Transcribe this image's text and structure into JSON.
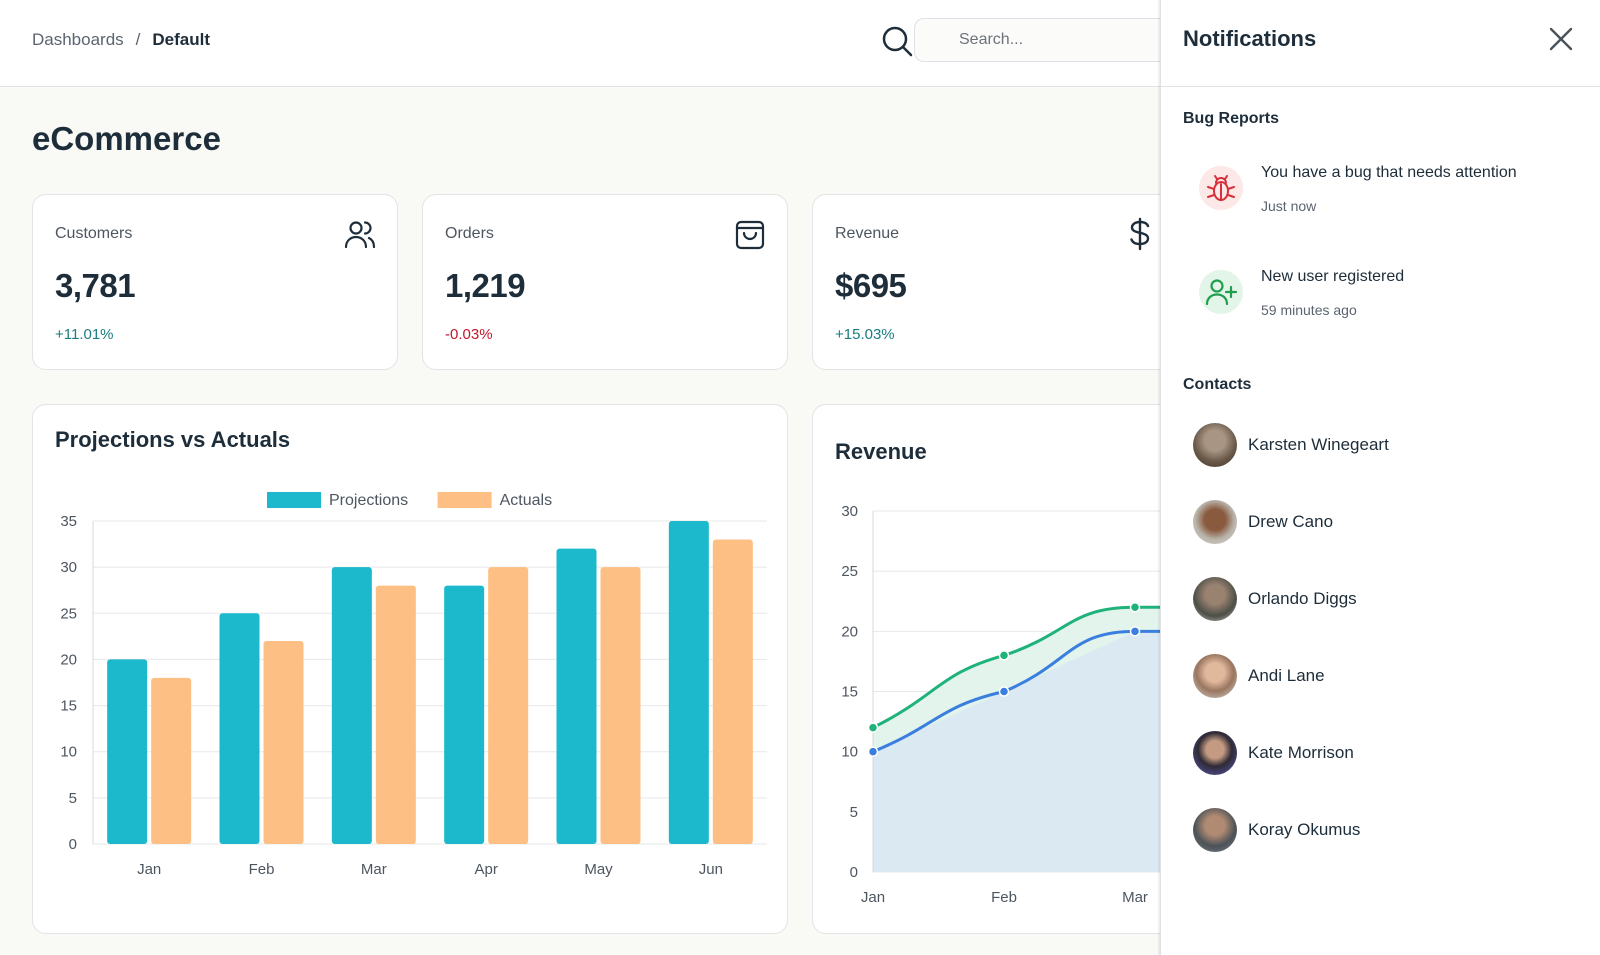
{
  "header": {
    "breadcrumb": [
      "Dashboards",
      "/",
      "Default"
    ],
    "search_placeholder": "Search..."
  },
  "page": {
    "title": "eCommerce"
  },
  "stats": [
    {
      "label": "Customers",
      "value": "3,781",
      "change": "+11.01%",
      "icon": "users-icon",
      "change_color": "#1a7d80"
    },
    {
      "label": "Orders",
      "value": "1,219",
      "change": "-0.03%",
      "icon": "shopping-bag-icon",
      "change_color": "#c0172b"
    },
    {
      "label": "Revenue",
      "value": "$695",
      "change": "+15.03%",
      "icon": "dollar-icon",
      "change_color": "#1a7d80"
    }
  ],
  "chart_data": [
    {
      "type": "bar",
      "title": "Projections vs Actuals",
      "categories": [
        "Jan",
        "Feb",
        "Mar",
        "Apr",
        "May",
        "Jun"
      ],
      "series": [
        {
          "name": "Projections",
          "values": [
            20,
            25,
            30,
            28,
            32,
            35
          ],
          "color": "#1cb8cc"
        },
        {
          "name": "Actuals",
          "values": [
            18,
            22,
            28,
            30,
            30,
            33
          ],
          "color": "#fdbf84"
        }
      ],
      "ylim": [
        0,
        35
      ],
      "yticks": [
        0,
        5,
        10,
        15,
        20,
        25,
        30,
        35
      ],
      "legend": "top-center",
      "grid": true
    },
    {
      "type": "area",
      "title": "Revenue",
      "categories": [
        "Jan",
        "Feb",
        "Mar"
      ],
      "series": [
        {
          "values": [
            12,
            18,
            22
          ],
          "color": "#1fb27a"
        },
        {
          "values": [
            10,
            15,
            20
          ],
          "color": "#3a7fe0"
        }
      ],
      "ylim": [
        0,
        30
      ],
      "yticks": [
        0,
        5,
        10,
        15,
        20,
        25,
        30
      ],
      "grid": true
    }
  ],
  "notifications": {
    "title": "Notifications",
    "section_bug": "Bug Reports",
    "items": [
      {
        "title": "You have a bug that needs attention",
        "time": "Just now",
        "icon": "bug-icon",
        "color": "#d6303a",
        "bg": "#fde8e8"
      },
      {
        "title": "New user registered",
        "time": "59 minutes ago",
        "icon": "user-plus-icon",
        "color": "#1f9e4d",
        "bg": "#e3f5e9"
      }
    ],
    "section_contacts": "Contacts",
    "contacts": [
      {
        "name": "Karsten Winegeart",
        "color": "#6b5a4a"
      },
      {
        "name": "Drew Cano",
        "color": "#7a4f38"
      },
      {
        "name": "Orlando Diggs",
        "color": "#4c4f47"
      },
      {
        "name": "Andi Lane",
        "color": "#9a7660"
      },
      {
        "name": "Kate Morrison",
        "color": "#5a5fb8"
      },
      {
        "name": "Koray Okumus",
        "color": "#4b5258"
      }
    ]
  }
}
